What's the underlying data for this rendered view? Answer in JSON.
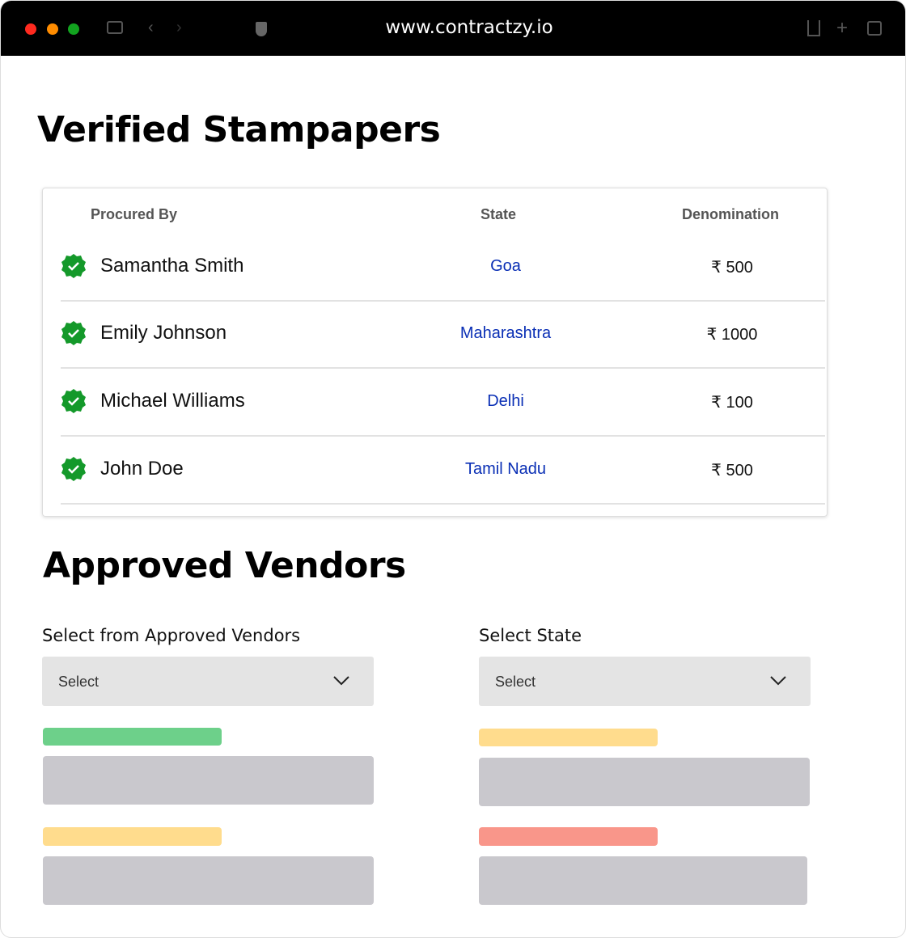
{
  "browser": {
    "url": "www.contractzy.io"
  },
  "stampapers": {
    "title": "Verified Stampapers",
    "headers": {
      "procured_by": "Procured By",
      "state": "State",
      "denomination": "Denomination"
    },
    "rows": [
      {
        "name": "Samantha Smith",
        "state": "Goa",
        "denomination": "₹ 500"
      },
      {
        "name": "Emily Johnson",
        "state": "Maharashtra",
        "denomination": "₹ 1000"
      },
      {
        "name": "Michael Williams",
        "state": "Delhi",
        "denomination": "₹ 100"
      },
      {
        "name": "John Doe",
        "state": "Tamil Nadu",
        "denomination": "₹ 500"
      }
    ]
  },
  "vendors": {
    "title": "Approved Vendors",
    "vendor_label": "Select from Approved Vendors",
    "vendor_select": "Select",
    "state_label": "Select State",
    "state_select": "Select"
  },
  "colors": {
    "verified": "#14992a",
    "link": "#0a2fb5",
    "green": "#6dd08a",
    "yellow": "#ffdc8d",
    "red": "#f9968a",
    "placeholder": "#c9c8cd"
  }
}
